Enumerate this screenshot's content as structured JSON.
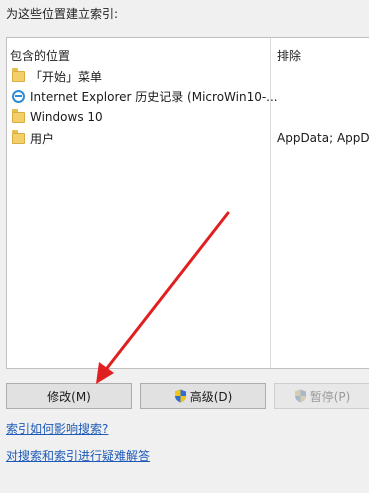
{
  "heading": "为这些位置建立索引:",
  "table": {
    "col_locations": "包含的位置",
    "col_exclude": "排除",
    "rows": [
      {
        "icon": "folder-icon",
        "label": "「开始」菜单",
        "exclude": ""
      },
      {
        "icon": "ie-icon",
        "label": "Internet Explorer 历史记录 (MicroWin10-...",
        "exclude": ""
      },
      {
        "icon": "folder-icon",
        "label": "Windows 10",
        "exclude": ""
      },
      {
        "icon": "folder-icon",
        "label": "用户",
        "exclude": "AppData; AppDa"
      }
    ]
  },
  "buttons": {
    "modify": "修改(M)",
    "advanced": "高级(D)",
    "pause": "暂停(P)"
  },
  "links": {
    "how_index": "索引如何影响搜索?",
    "troubleshoot": "对搜索和索引进行疑难解答"
  },
  "colors": {
    "link": "#1e5bb8",
    "arrow": "#e02020",
    "shield_blue": "#2e6fd0",
    "shield_yellow": "#f0c419"
  }
}
